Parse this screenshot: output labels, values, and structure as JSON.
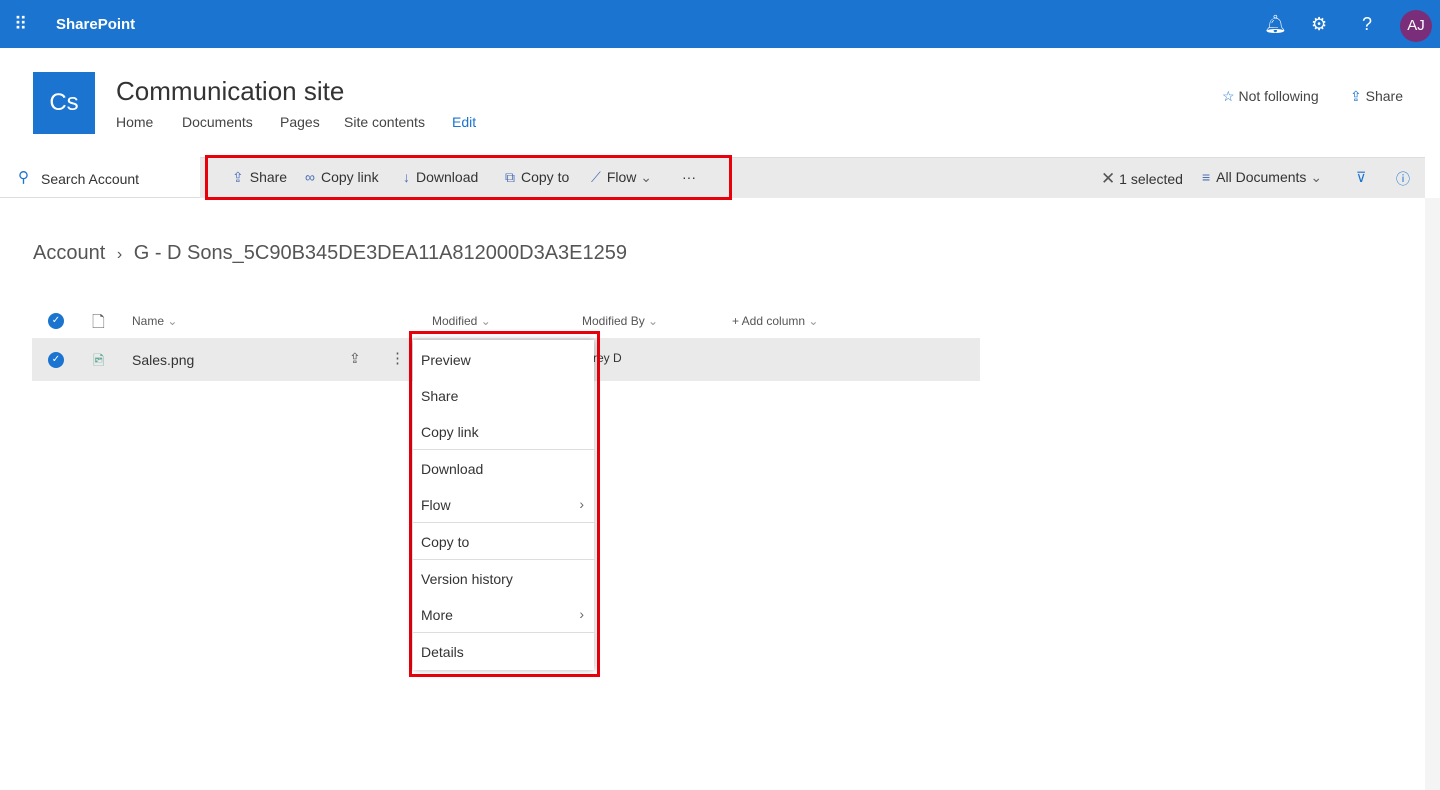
{
  "app": {
    "name": "SharePoint",
    "avatar": "AJ"
  },
  "site": {
    "logo": "Cs",
    "title": "Communication site",
    "nav": [
      "Home",
      "Documents",
      "Pages",
      "Site contents",
      "Edit"
    ],
    "follow": "Not following",
    "share": "Share"
  },
  "search": {
    "placeholder": "Search Account"
  },
  "commands": {
    "share": "Share",
    "copy_link": "Copy link",
    "download": "Download",
    "copy_to": "Copy to",
    "flow": "Flow",
    "more": "···",
    "selected": "1 selected",
    "view": "All Documents"
  },
  "breadcrumb": {
    "root": "Account",
    "current": "G - D Sons_5C90B345DE3DEA11A812000D3A3E1259"
  },
  "columns": {
    "name": "Name",
    "modified": "Modified",
    "modified_by": "Modified By",
    "add": "+ Add column"
  },
  "rows": [
    {
      "name": "Sales.png",
      "modified_by": "rey D",
      "selected": true
    }
  ],
  "menu": [
    "Preview",
    "Share",
    "Copy link",
    "Download",
    "Flow",
    "Copy to",
    "Version history",
    "More",
    "Details"
  ],
  "colors": {
    "accent": "#1b74d0",
    "highlight": "#e8000b"
  }
}
